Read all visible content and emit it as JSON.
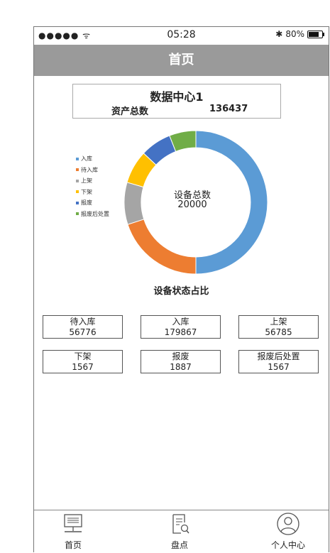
{
  "status_bar": {
    "signal": "●●●●● ᯤ",
    "time": "05:28",
    "bluetooth": "✱",
    "battery_label": "80%",
    "battery_level": 0.8
  },
  "header": {
    "title": "首页"
  },
  "data_center": {
    "name": "数据中心1",
    "asset_label": "资产总数",
    "asset_value": "136437"
  },
  "chart_data": {
    "type": "pie",
    "style": "donut",
    "center_label": "设备总数",
    "center_value": "20000",
    "caption": "设备状态占比",
    "legend_position": "left",
    "slices": [
      {
        "label": "入库",
        "value": 50.0,
        "color": "#5b9bd5"
      },
      {
        "label": "待入库",
        "value": 20.0,
        "color": "#ed7d31"
      },
      {
        "label": "上架",
        "value": 9.5,
        "color": "#a5a5a5"
      },
      {
        "label": "下架",
        "value": 7.5,
        "color": "#ffc000"
      },
      {
        "label": "报废",
        "value": 7.0,
        "color": "#4472c4"
      },
      {
        "label": "报废后处置",
        "value": 6.0,
        "color": "#70ad47"
      }
    ]
  },
  "stats": [
    {
      "label": "待入库",
      "value": "56776"
    },
    {
      "label": "入库",
      "value": "179867"
    },
    {
      "label": "上架",
      "value": "56785"
    },
    {
      "label": "下架",
      "value": "1567"
    },
    {
      "label": "报废",
      "value": "1887"
    },
    {
      "label": "报废后处置",
      "value": "1567"
    }
  ],
  "tabs": [
    {
      "label": "首页",
      "icon": "monitor-icon"
    },
    {
      "label": "盘点",
      "icon": "document-search-icon"
    },
    {
      "label": "个人中心",
      "icon": "user-icon"
    }
  ]
}
